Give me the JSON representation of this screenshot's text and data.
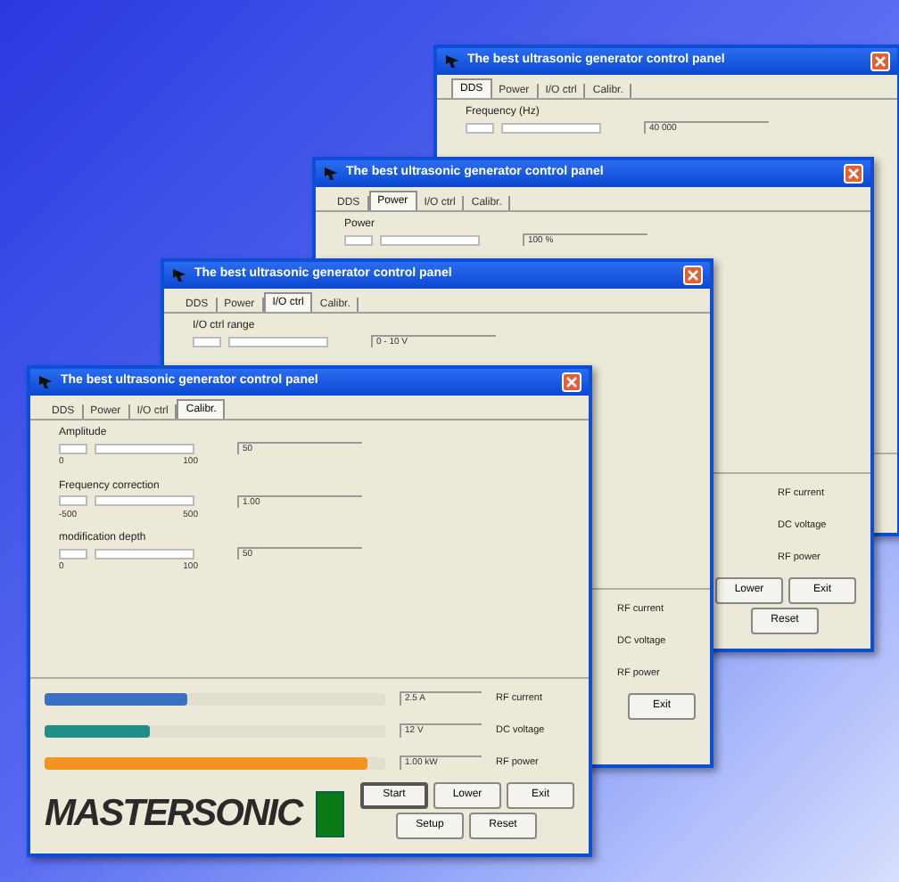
{
  "windows": [
    {
      "title": "The best ultrasonic generator control panel",
      "tabs": [
        {
          "label": "DDS",
          "selected": true
        },
        {
          "label": "Power",
          "selected": false
        },
        {
          "label": "I/O ctrl",
          "selected": false
        },
        {
          "label": "Calibr.",
          "selected": false
        }
      ],
      "fields": [
        {
          "label": "Frequency (Hz)",
          "reading": "40 000"
        }
      ]
    },
    {
      "title": "The best ultrasonic generator control panel",
      "tabs": [
        {
          "label": "DDS",
          "selected": false
        },
        {
          "label": "Power",
          "selected": true
        },
        {
          "label": "I/O ctrl",
          "selected": false
        },
        {
          "label": "Calibr.",
          "selected": false
        }
      ],
      "fields": [
        {
          "label": "Power",
          "reading": "100 %"
        }
      ],
      "meters": [
        {
          "label": "RF current"
        },
        {
          "label": "DC voltage"
        },
        {
          "label": "RF power"
        }
      ],
      "button_rows": [
        [
          {
            "label": "Lower"
          },
          {
            "label": "Exit"
          }
        ],
        [
          {
            "label": "Reset"
          }
        ]
      ]
    },
    {
      "title": "The best ultrasonic generator control panel",
      "tabs": [
        {
          "label": "DDS",
          "selected": false
        },
        {
          "label": "Power",
          "selected": false
        },
        {
          "label": "I/O ctrl",
          "selected": true
        },
        {
          "label": "Calibr.",
          "selected": false
        }
      ],
      "fields": [
        {
          "label": "I/O ctrl range",
          "reading": "0 - 10 V"
        }
      ],
      "meters": [
        {
          "label": "RF current"
        },
        {
          "label": "DC voltage"
        },
        {
          "label": "RF power"
        }
      ],
      "button_rows": [
        [
          {
            "label": "Exit"
          }
        ]
      ]
    },
    {
      "title": "The best ultrasonic generator control panel",
      "tabs": [
        {
          "label": "DDS",
          "selected": false
        },
        {
          "label": "Power",
          "selected": false
        },
        {
          "label": "I/O ctrl",
          "selected": false
        },
        {
          "label": "Calibr.",
          "selected": true
        }
      ],
      "fields": [
        {
          "label": "Amplitude",
          "reading": "50",
          "min": "0",
          "max": "100"
        },
        {
          "label": "Frequency correction",
          "reading": "1.00",
          "min": "-500",
          "max": "500"
        },
        {
          "label": "modification depth",
          "reading": "50",
          "min": "0",
          "max": "100"
        }
      ],
      "meters": [
        {
          "label": "RF current",
          "reading": "2.5 A",
          "level": 0.42,
          "color": "#3a6fc4"
        },
        {
          "label": "DC voltage",
          "reading": "12 V",
          "level": 0.31,
          "color": "#1f9088"
        },
        {
          "label": "RF power",
          "reading": "1.00 kW",
          "level": 0.95,
          "color": "#f39422"
        }
      ],
      "logo": {
        "text": "MASTERSONIC"
      },
      "button_rows": [
        [
          {
            "label": "Start",
            "focused": true
          },
          {
            "label": "Lower",
            "focused": false
          },
          {
            "label": "Exit",
            "focused": false
          }
        ],
        [
          {
            "label": "Setup",
            "focused": false
          },
          {
            "label": "Reset",
            "focused": false
          }
        ]
      ]
    }
  ]
}
